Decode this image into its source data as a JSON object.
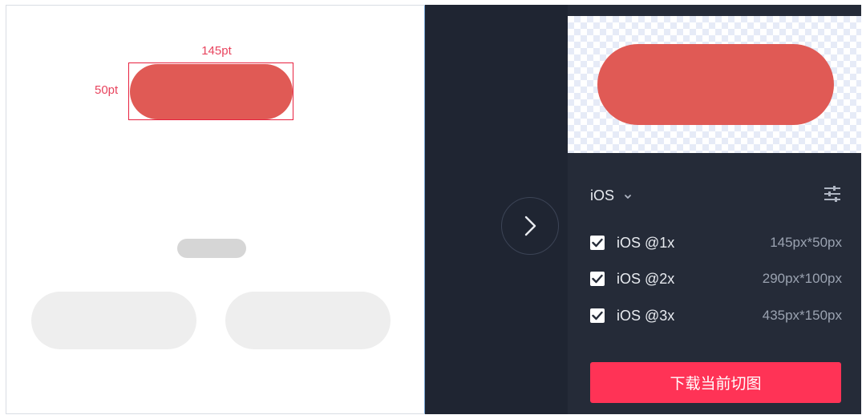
{
  "canvas": {
    "width_label": "145pt",
    "height_label": "50pt"
  },
  "panel": {
    "platform_label": "iOS",
    "exports": [
      {
        "label": "iOS @1x",
        "size": "145px*50px",
        "checked": true
      },
      {
        "label": "iOS @2x",
        "size": "290px*100px",
        "checked": true
      },
      {
        "label": "iOS @3x",
        "size": "435px*150px",
        "checked": true
      }
    ],
    "export_button": "下载当前切图"
  },
  "colors": {
    "accent": "#ff3356",
    "slice_fill": "#e05a55",
    "measure": "#e8445e",
    "panel_bg": "#252b38"
  },
  "icons": {
    "next": "chevron-right-icon",
    "dropdown": "chevron-down-icon",
    "settings": "sliders-icon",
    "check": "checkmark-icon"
  }
}
